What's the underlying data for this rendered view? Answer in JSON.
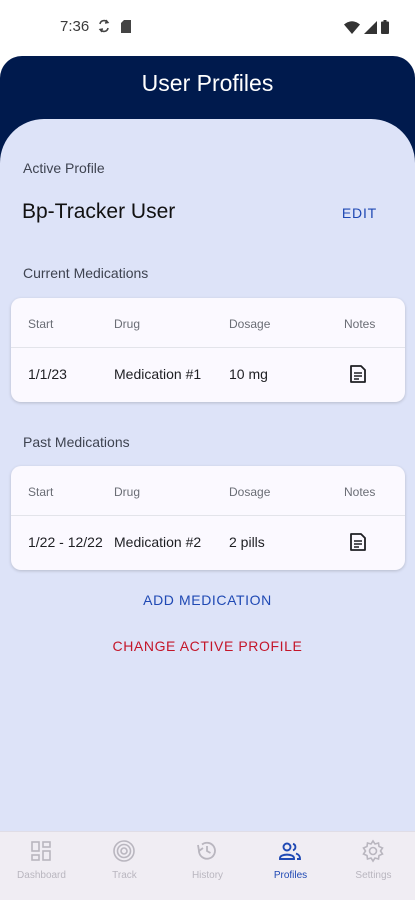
{
  "status_bar": {
    "time": "7:36",
    "icons": [
      "sync-icon",
      "sd-card-icon",
      "wifi-icon",
      "signal-icon",
      "battery-icon"
    ]
  },
  "header": {
    "title": "User Profiles"
  },
  "active_profile": {
    "label": "Active Profile",
    "name": "Bp-Tracker User",
    "edit_label": "EDIT"
  },
  "current_medications": {
    "label": "Current Medications",
    "columns": [
      "Start",
      "Drug",
      "Dosage",
      "Notes"
    ],
    "rows": [
      {
        "start": "1/1/23",
        "drug": "Medication #1",
        "dosage": "10 mg",
        "notes_icon": "note-icon"
      }
    ]
  },
  "past_medications": {
    "label": "Past Medications",
    "columns": [
      "Start",
      "Drug",
      "Dosage",
      "Notes"
    ],
    "rows": [
      {
        "start": "1/22 - 12/22",
        "drug": "Medication #2",
        "dosage": "2 pills",
        "notes_icon": "note-icon"
      }
    ]
  },
  "actions": {
    "add_medication": "ADD MEDICATION",
    "change_profile": "CHANGE ACTIVE PROFILE"
  },
  "bottom_nav": {
    "items": [
      {
        "label": "Dashboard",
        "icon": "dashboard-icon",
        "active": false
      },
      {
        "label": "Track",
        "icon": "target-icon",
        "active": false
      },
      {
        "label": "History",
        "icon": "history-icon",
        "active": false
      },
      {
        "label": "Profiles",
        "icon": "people-icon",
        "active": true
      },
      {
        "label": "Settings",
        "icon": "gear-icon",
        "active": false
      }
    ]
  },
  "colors": {
    "header_bg": "#001a4d",
    "panel_bg": "#dde3f8",
    "accent_blue": "#1f49b4",
    "danger_red": "#c4162a"
  }
}
